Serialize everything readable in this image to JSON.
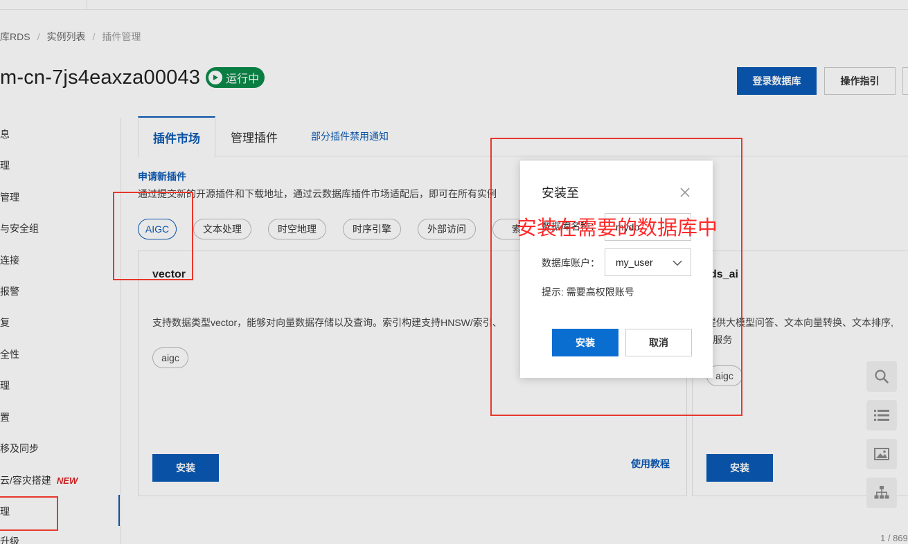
{
  "breadcrumb": {
    "item1": "库RDS",
    "item2": "实例列表",
    "item3": "插件管理"
  },
  "header": {
    "instance_id": "m-cn-7js4eaxza00043",
    "status": "运行中",
    "login_db_label": "登录数据库",
    "guide_label": "操作指引"
  },
  "sidebar": {
    "items": [
      "息",
      "理",
      "管理",
      "与安全组",
      "连接",
      "报警",
      "复",
      "全性",
      "理",
      "置",
      "移及同步",
      "云/容灾搭建",
      "理",
      "升级"
    ],
    "new_badge": "NEW"
  },
  "tabs": {
    "market": "插件市场",
    "manage": "管理插件",
    "notice": "部分插件禁用通知"
  },
  "apply": {
    "title": "申请新插件",
    "desc": "通过提交新的开源插件和下载地址，通过云数据库插件市场适配后，即可在所有实例"
  },
  "chips": [
    "AIGC",
    "文本处理",
    "时空地理",
    "时序引擎",
    "外部访问",
    "索引"
  ],
  "cards": {
    "vector": {
      "title": "vector",
      "desc": "支持数据类型vector，能够对向量数据存储以及查询。索引构建支持HNSW/索引、",
      "tag": "aigc",
      "install_label": "安装",
      "tutorial_label": "使用教程"
    },
    "rds_ai": {
      "title": "ds_ai",
      "desc_line1": "提供大模型问答、文本向量转换、文本排序,",
      "desc_line2": "B服务",
      "tag": "aigc",
      "install_label": "安装"
    }
  },
  "float_icons": [
    "search-icon",
    "list-icon",
    "image-icon",
    "sitemap-icon"
  ],
  "pager": "1 / 869",
  "modal": {
    "title": "安装至",
    "db_name_label": "数据库名称：",
    "db_name_value": "mydb",
    "db_account_label": "数据库账户：",
    "db_account_value": "my_user",
    "hint": "提示: 需要高权限账号",
    "install_label": "安装",
    "cancel_label": "取消"
  },
  "annotation": "安装在需要的数据库中",
  "colors": {
    "primary": "#0a5ab5",
    "status_green": "#0c8a4a",
    "annotation_red": "#ff2a2a",
    "new_red": "#e02020"
  }
}
